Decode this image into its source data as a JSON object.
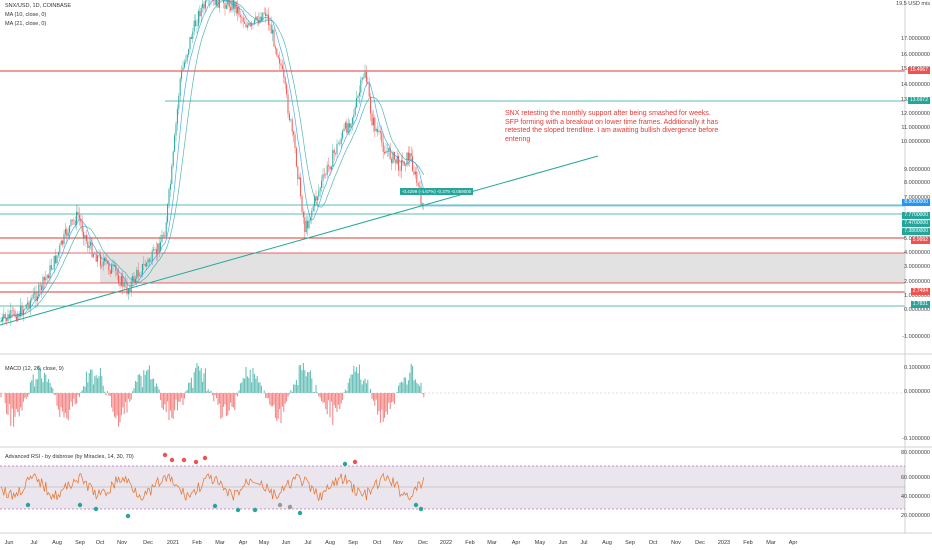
{
  "header": {
    "symbol_line": "SNX/USD, 1D, COINBASE",
    "ma_fast": "MA (10, close, 0)",
    "ma_slow": "MA (21, close, 0)"
  },
  "macd_label": "MACD (12, 26, close, 9)",
  "rsi_label": "Advanced RSI - by disbrose (by Miracles, 14, 30, 70)",
  "annotation": "SNX retesting the monthly support after being smashed for weeks. SFP forming with a breakout on lower time frames. Additionally it has retested the sloped trendline. I am awaiting bullish divergence before entering",
  "measure_label": "-0.4299 (-4.67%) -0.379 -0.069000",
  "price_axis": [
    "19.5 USD mis",
    "17.0000000",
    "16.0000000",
    "15.0000000",
    "14.0000000",
    "13.0000000",
    "12.0000000",
    "11.0000000",
    "10.0000000",
    "9.0000000",
    "8.0000000",
    "7.0000000",
    "6.0000000",
    "5.0000000",
    "4.0000000",
    "3.0000000",
    "2.0000000",
    "1.0000000",
    "0.0000000",
    "-1.0000000"
  ],
  "price_tags": [
    {
      "text": "15.4967",
      "color": "#ef5350"
    },
    {
      "text": "13.6972",
      "color": "#26a69a"
    },
    {
      "text": "8.8000000",
      "color": "#2196f3"
    },
    {
      "text": "7.7700000",
      "color": "#26a69a"
    },
    {
      "text": "7.4700000",
      "color": "#26a69a"
    },
    {
      "text": "7.3800000",
      "color": "#26a69a"
    },
    {
      "text": "5.9992",
      "color": "#ef5350"
    },
    {
      "text": "2.7494",
      "color": "#ef5350"
    },
    {
      "text": "1.7831",
      "color": "#26a69a"
    }
  ],
  "macd_axis": [
    "0.1000000",
    "0.0000000",
    "-0.1000000"
  ],
  "rsi_axis": [
    "80.0000000",
    "60.0000000",
    "40.0000000",
    "20.0000000"
  ],
  "time_axis": [
    "Jun",
    "Jul",
    "Aug",
    "Sep",
    "Oct",
    "Nov",
    "Dec",
    "2021",
    "Feb",
    "Mar",
    "Apr",
    "May",
    "Jun",
    "Jul",
    "Aug",
    "Sep",
    "Oct",
    "Nov",
    "Dec",
    "2022",
    "Feb",
    "Mar",
    "Apr",
    "May",
    "Jun",
    "Jul",
    "Aug",
    "Sep",
    "Oct",
    "Nov",
    "Dec",
    "2023",
    "Feb",
    "Mar",
    "Apr"
  ],
  "colors": {
    "bull": "#26a69a",
    "bear": "#ef5350",
    "resistance": "#e53935",
    "support": "#26a69a",
    "trendline": "#26a69a",
    "rsi_zone": "#5e2a6e"
  }
}
